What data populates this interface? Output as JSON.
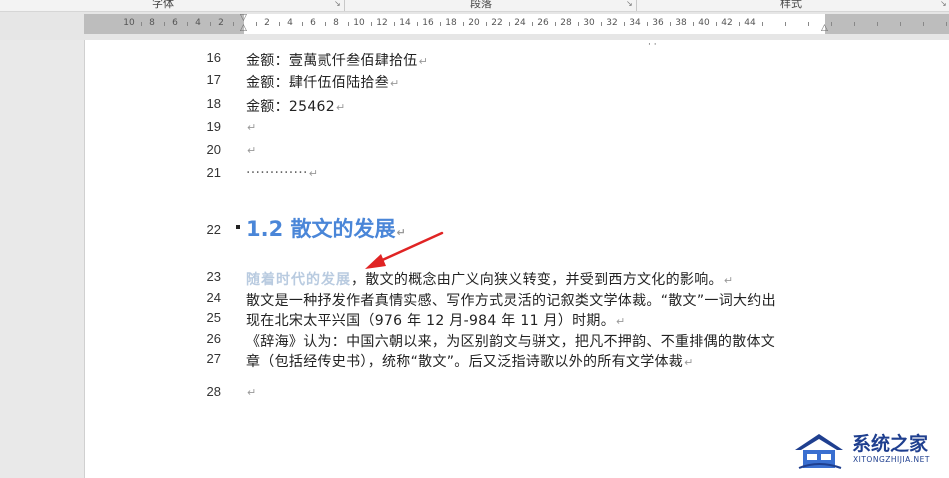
{
  "ribbon": {
    "group_font": "字体",
    "group_paragraph": "段落",
    "group_styles": "样式"
  },
  "ruler": {
    "left_numbers": [
      "10",
      "8",
      "6",
      "4",
      "2"
    ],
    "right_numbers": [
      "2",
      "4",
      "6",
      "8",
      "10",
      "12",
      "14",
      "16",
      "18",
      "20",
      "22",
      "24",
      "26",
      "28",
      "30",
      "32",
      "34",
      "36",
      "38",
      "40",
      "42",
      "44"
    ]
  },
  "document": {
    "partial_top_mark": "·  ·",
    "lines": [
      {
        "num": "16",
        "text": "金额：壹萬贰仟叁佰肆拾伍"
      },
      {
        "num": "17",
        "text": "金额：肆仟伍佰陆拾叁"
      },
      {
        "num": "18",
        "text": "金额：25462"
      },
      {
        "num": "19",
        "text": ""
      },
      {
        "num": "20",
        "text": ""
      },
      {
        "num": "21",
        "text": "·············"
      },
      {
        "num": "22",
        "text": "1.2 散文的发展"
      },
      {
        "num": "23",
        "text_faded": "随着时代的发展",
        "text": "，散文的概念由广义向狭义转变，并受到西方文化的影响。"
      },
      {
        "num": "24",
        "text": "散文是一种抒发作者真情实感、写作方式灵活的记叙类文学体裁。“散文”一词大约出"
      },
      {
        "num": "25",
        "text": "现在北宋太平兴国（976 年 12 月-984 年 11 月）时期。"
      },
      {
        "num": "26",
        "text": "《辞海》认为：中国六朝以来，为区别韵文与骈文，把凡不押韵、不重排偶的散体文"
      },
      {
        "num": "27",
        "text": "章（包括经传史书），统称“散文”。后又泛指诗歌以外的所有文学体裁"
      },
      {
        "num": "28",
        "text": ""
      }
    ]
  },
  "paragraph_mark": "↵",
  "watermark": {
    "name": "系统之家",
    "url": "XITONGZHIJIA.NET"
  },
  "colors": {
    "heading": "#4a86d8",
    "arrow": "#e02424",
    "faded_text": "#b9cbe0"
  }
}
